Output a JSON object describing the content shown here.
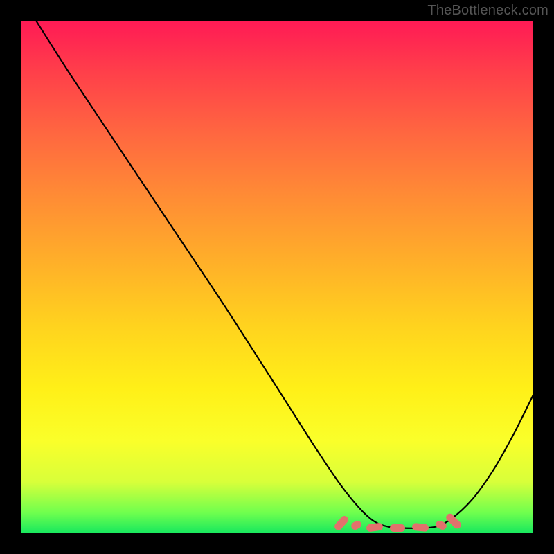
{
  "watermark": "TheBottleneck.com",
  "chart_data": {
    "type": "line",
    "title": "",
    "xlabel": "",
    "ylabel": "",
    "xlim": [
      0,
      100
    ],
    "ylim": [
      0,
      100
    ],
    "grid": false,
    "legend": false,
    "series": [
      {
        "name": "bottleneck-curve",
        "x": [
          3,
          10,
          20,
          30,
          40,
          49,
          56,
          62,
          66,
          69,
          72,
          75,
          78,
          81,
          84,
          88,
          92,
          96,
          100
        ],
        "y": [
          100,
          89,
          74,
          59,
          44,
          30,
          19,
          10,
          5,
          2.3,
          1.2,
          1.0,
          1.0,
          1.3,
          2.8,
          6.5,
          12,
          19,
          27
        ]
      }
    ],
    "highlight": {
      "name": "optimal-range",
      "points": [
        {
          "x": 62.5,
          "y": 2.0,
          "len": 3.2,
          "angle": -48
        },
        {
          "x": 65.5,
          "y": 1.6,
          "len": 2.0,
          "angle": -30
        },
        {
          "x": 69.0,
          "y": 1.1,
          "len": 3.2,
          "angle": -8
        },
        {
          "x": 73.5,
          "y": 1.0,
          "len": 3.0,
          "angle": 0
        },
        {
          "x": 78.0,
          "y": 1.1,
          "len": 3.2,
          "angle": 6
        },
        {
          "x": 82.0,
          "y": 1.6,
          "len": 2.2,
          "angle": 25
        },
        {
          "x": 84.5,
          "y": 2.3,
          "len": 3.5,
          "angle": 45
        }
      ]
    },
    "background_gradient": {
      "top": "#ff1a55",
      "middle": "#ffd41e",
      "bottom": "#16e85e"
    }
  }
}
